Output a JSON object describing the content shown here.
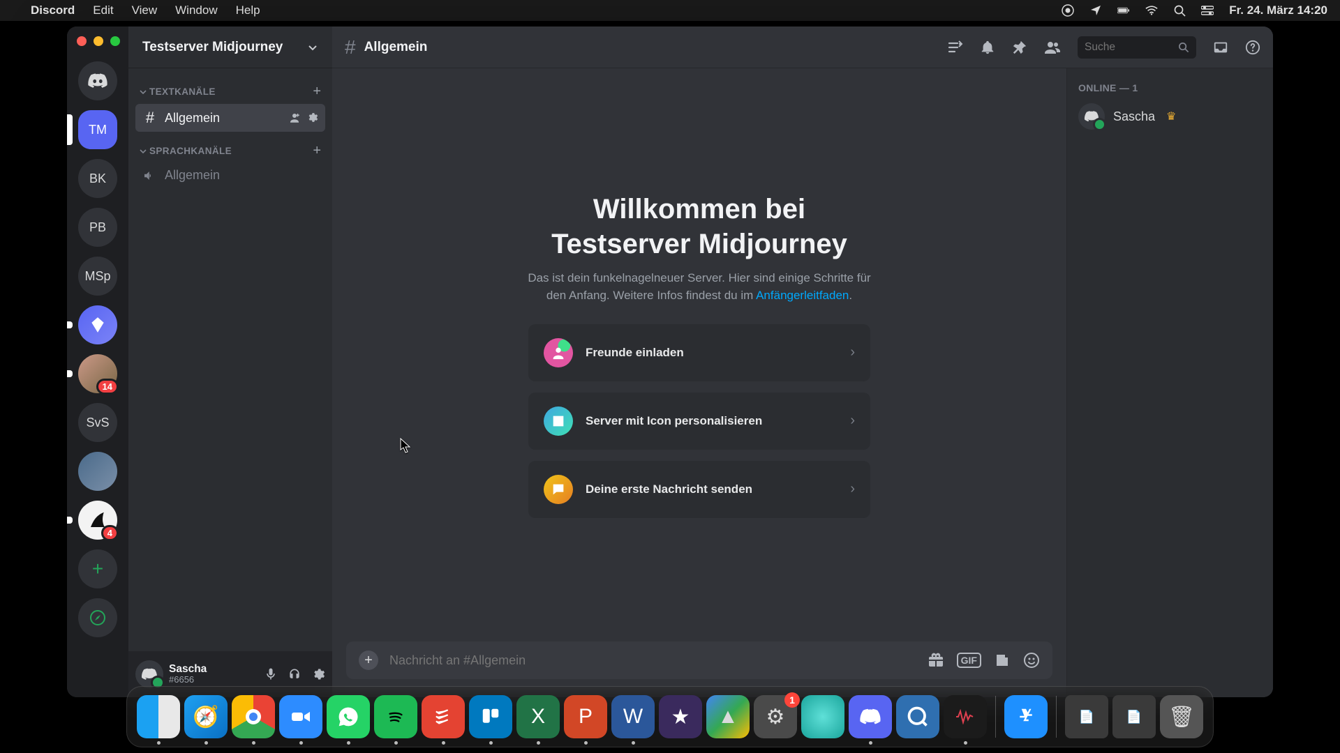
{
  "menubar": {
    "app": "Discord",
    "items": [
      "Edit",
      "View",
      "Window",
      "Help"
    ],
    "clock": "Fr. 24. März  14:20"
  },
  "guilds": {
    "active_label": "TM",
    "list": [
      {
        "label": "BK"
      },
      {
        "label": "PB"
      },
      {
        "label": "MSp"
      }
    ],
    "badge1": "14",
    "badge2": "4",
    "svs": "SvS"
  },
  "server": {
    "name": "Testserver Midjourney",
    "sections": {
      "text": "TEXTKANÄLE",
      "voice": "SPRACHKANÄLE"
    },
    "text_channel": "Allgemein",
    "voice_channel": "Allgemein"
  },
  "user": {
    "name": "Sascha",
    "tag": "#6656"
  },
  "topbar": {
    "channel": "Allgemein",
    "search_placeholder": "Suche"
  },
  "welcome": {
    "title_line1": "Willkommen bei",
    "title_line2": "Testserver Midjourney",
    "desc_pre": "Das ist dein funkelnagelneuer Server. Hier sind einige Schritte für den Anfang. Weitere Infos findest du im ",
    "desc_link": "Anfängerleitfaden",
    "desc_post": ".",
    "cards": [
      "Freunde einladen",
      "Server mit Icon personalisieren",
      "Deine erste Nachricht senden"
    ]
  },
  "composer": {
    "placeholder": "Nachricht an #Allgemein",
    "gif": "GIF"
  },
  "members": {
    "header": "ONLINE — 1",
    "name": "Sascha"
  },
  "dock": {
    "settings_badge": "1"
  }
}
